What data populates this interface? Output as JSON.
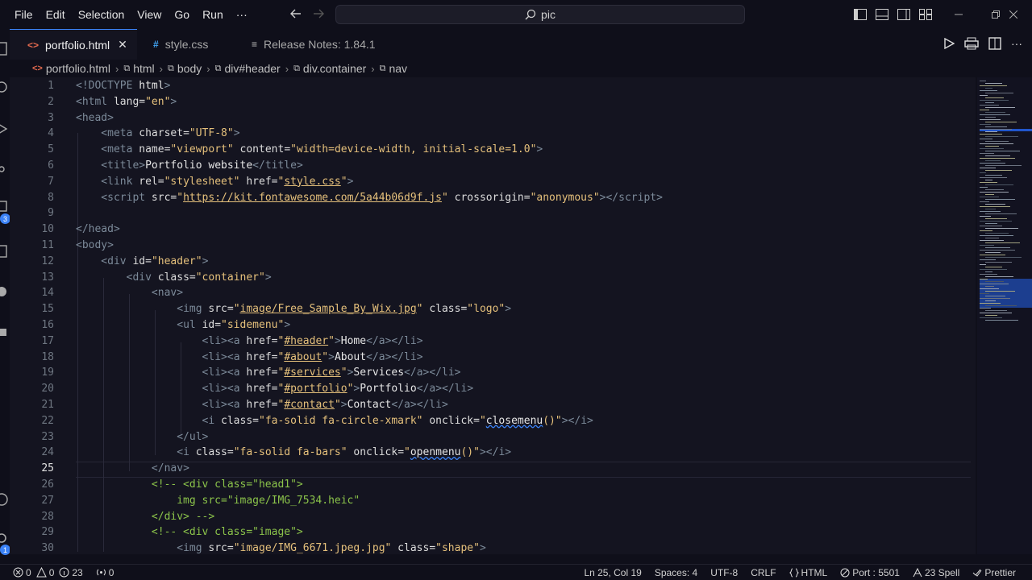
{
  "menu": [
    "File",
    "Edit",
    "Selection",
    "View",
    "Go",
    "Run",
    "···"
  ],
  "search": {
    "text": "pic"
  },
  "tabs": [
    {
      "label": "portfolio.html",
      "icon": "html-file-icon",
      "active": true
    },
    {
      "label": "style.css",
      "icon": "css-file-icon",
      "active": false
    },
    {
      "label": "Release Notes: 1.84.1",
      "icon": "release-notes-icon",
      "active": false
    }
  ],
  "breadcrumb": [
    "portfolio.html",
    "html",
    "body",
    "div#header",
    "div.container",
    "nav"
  ],
  "editor": {
    "current_line": 25,
    "lines": [
      [
        [
          "<!",
          "doc"
        ],
        [
          "DOCTYPE ",
          "doc"
        ],
        [
          "html",
          "name"
        ],
        [
          ">",
          "doc"
        ]
      ],
      [
        [
          "<",
          "tag"
        ],
        [
          "html",
          "tag"
        ],
        [
          " lang",
          "attr"
        ],
        [
          "=",
          "attr"
        ],
        [
          "\"en\"",
          "str"
        ],
        [
          ">",
          "tag"
        ]
      ],
      [
        [
          "<",
          "tag"
        ],
        [
          "head",
          "tag"
        ],
        [
          ">",
          "tag"
        ]
      ],
      [
        [
          "    <",
          "tag"
        ],
        [
          "meta",
          "tag"
        ],
        [
          " charset",
          "attr"
        ],
        [
          "=",
          "attr"
        ],
        [
          "\"UTF-8\"",
          "str"
        ],
        [
          ">",
          "tag"
        ]
      ],
      [
        [
          "    <",
          "tag"
        ],
        [
          "meta",
          "tag"
        ],
        [
          " name",
          "attr"
        ],
        [
          "=",
          "attr"
        ],
        [
          "\"viewport\"",
          "str"
        ],
        [
          " content",
          "attr"
        ],
        [
          "=",
          "attr"
        ],
        [
          "\"width=device-width, initial-scale=1.0\"",
          "str"
        ],
        [
          ">",
          "tag"
        ]
      ],
      [
        [
          "    <",
          "tag"
        ],
        [
          "title",
          "tag"
        ],
        [
          ">",
          "tag"
        ],
        [
          "Portfolio website",
          "text"
        ],
        [
          "</",
          "tag"
        ],
        [
          "title",
          "tag"
        ],
        [
          ">",
          "tag"
        ]
      ],
      [
        [
          "    <",
          "tag"
        ],
        [
          "link",
          "tag"
        ],
        [
          " rel",
          "attr"
        ],
        [
          "=",
          "attr"
        ],
        [
          "\"stylesheet\"",
          "str"
        ],
        [
          " href",
          "attr"
        ],
        [
          "=",
          "attr"
        ],
        [
          "\"",
          "str"
        ],
        [
          "style.css",
          "strul"
        ],
        [
          "\"",
          "str"
        ],
        [
          ">",
          "tag"
        ]
      ],
      [
        [
          "    <",
          "tag"
        ],
        [
          "script",
          "tag"
        ],
        [
          " src",
          "attr"
        ],
        [
          "=",
          "attr"
        ],
        [
          "\"",
          "str"
        ],
        [
          "https://kit.fontawesome.com/5a44b06d9f.js",
          "strul"
        ],
        [
          "\"",
          "str"
        ],
        [
          " crossorigin",
          "attr"
        ],
        [
          "=",
          "attr"
        ],
        [
          "\"anonymous\"",
          "str"
        ],
        [
          "></",
          "tag"
        ],
        [
          "script",
          "tag"
        ],
        [
          ">",
          "tag"
        ]
      ],
      [],
      [
        [
          "</",
          "tag"
        ],
        [
          "head",
          "tag"
        ],
        [
          ">",
          "tag"
        ]
      ],
      [
        [
          "<",
          "tag"
        ],
        [
          "body",
          "tag"
        ],
        [
          ">",
          "tag"
        ]
      ],
      [
        [
          "    <",
          "tag"
        ],
        [
          "div",
          "tag"
        ],
        [
          " id",
          "attr"
        ],
        [
          "=",
          "attr"
        ],
        [
          "\"header\"",
          "str"
        ],
        [
          ">",
          "tag"
        ]
      ],
      [
        [
          "        <",
          "tag"
        ],
        [
          "div",
          "tag"
        ],
        [
          " class",
          "attr"
        ],
        [
          "=",
          "attr"
        ],
        [
          "\"container\"",
          "str"
        ],
        [
          ">",
          "tag"
        ]
      ],
      [
        [
          "            <",
          "tag"
        ],
        [
          "nav",
          "tag"
        ],
        [
          ">",
          "tag"
        ]
      ],
      [
        [
          "                <",
          "tag"
        ],
        [
          "img",
          "tag"
        ],
        [
          " src",
          "attr"
        ],
        [
          "=",
          "attr"
        ],
        [
          "\"",
          "str"
        ],
        [
          "image/Free_Sample_By_Wix.jpg",
          "strul"
        ],
        [
          "\"",
          "str"
        ],
        [
          " class",
          "attr"
        ],
        [
          "=",
          "attr"
        ],
        [
          "\"logo\"",
          "str"
        ],
        [
          ">",
          "tag"
        ]
      ],
      [
        [
          "                <",
          "tag"
        ],
        [
          "ul",
          "tag"
        ],
        [
          " id",
          "attr"
        ],
        [
          "=",
          "attr"
        ],
        [
          "\"sidemenu\"",
          "str"
        ],
        [
          ">",
          "tag"
        ]
      ],
      [
        [
          "                    <",
          "tag"
        ],
        [
          "li",
          "tag"
        ],
        [
          "><",
          "tag"
        ],
        [
          "a",
          "tag"
        ],
        [
          " href",
          "attr"
        ],
        [
          "=",
          "attr"
        ],
        [
          "\"",
          "str"
        ],
        [
          "#header",
          "strul"
        ],
        [
          "\"",
          "str"
        ],
        [
          ">",
          "tag"
        ],
        [
          "Home",
          "text"
        ],
        [
          "</",
          "tag"
        ],
        [
          "a",
          "tag"
        ],
        [
          "></",
          "tag"
        ],
        [
          "li",
          "tag"
        ],
        [
          ">",
          "tag"
        ]
      ],
      [
        [
          "                    <",
          "tag"
        ],
        [
          "li",
          "tag"
        ],
        [
          "><",
          "tag"
        ],
        [
          "a",
          "tag"
        ],
        [
          " href",
          "attr"
        ],
        [
          "=",
          "attr"
        ],
        [
          "\"",
          "str"
        ],
        [
          "#about",
          "strul"
        ],
        [
          "\"",
          "str"
        ],
        [
          ">",
          "tag"
        ],
        [
          "About",
          "text"
        ],
        [
          "</",
          "tag"
        ],
        [
          "a",
          "tag"
        ],
        [
          "></",
          "tag"
        ],
        [
          "li",
          "tag"
        ],
        [
          ">",
          "tag"
        ]
      ],
      [
        [
          "                    <",
          "tag"
        ],
        [
          "li",
          "tag"
        ],
        [
          "><",
          "tag"
        ],
        [
          "a",
          "tag"
        ],
        [
          " href",
          "attr"
        ],
        [
          "=",
          "attr"
        ],
        [
          "\"",
          "str"
        ],
        [
          "#services",
          "strul"
        ],
        [
          "\"",
          "str"
        ],
        [
          ">",
          "tag"
        ],
        [
          "Services",
          "text"
        ],
        [
          "</",
          "tag"
        ],
        [
          "a",
          "tag"
        ],
        [
          "></",
          "tag"
        ],
        [
          "li",
          "tag"
        ],
        [
          ">",
          "tag"
        ]
      ],
      [
        [
          "                    <",
          "tag"
        ],
        [
          "li",
          "tag"
        ],
        [
          "><",
          "tag"
        ],
        [
          "a",
          "tag"
        ],
        [
          " href",
          "attr"
        ],
        [
          "=",
          "attr"
        ],
        [
          "\"",
          "str"
        ],
        [
          "#portfolio",
          "strul"
        ],
        [
          "\"",
          "str"
        ],
        [
          ">",
          "tag"
        ],
        [
          "Portfolio",
          "text"
        ],
        [
          "</",
          "tag"
        ],
        [
          "a",
          "tag"
        ],
        [
          "></",
          "tag"
        ],
        [
          "li",
          "tag"
        ],
        [
          ">",
          "tag"
        ]
      ],
      [
        [
          "                    <",
          "tag"
        ],
        [
          "li",
          "tag"
        ],
        [
          "><",
          "tag"
        ],
        [
          "a",
          "tag"
        ],
        [
          " href",
          "attr"
        ],
        [
          "=",
          "attr"
        ],
        [
          "\"",
          "str"
        ],
        [
          "#contact",
          "strul"
        ],
        [
          "\"",
          "str"
        ],
        [
          ">",
          "tag"
        ],
        [
          "Contact",
          "text"
        ],
        [
          "</",
          "tag"
        ],
        [
          "a",
          "tag"
        ],
        [
          "></",
          "tag"
        ],
        [
          "li",
          "tag"
        ],
        [
          ">",
          "tag"
        ]
      ],
      [
        [
          "                    <",
          "tag"
        ],
        [
          "i",
          "tag"
        ],
        [
          " class",
          "attr"
        ],
        [
          "=",
          "attr"
        ],
        [
          "\"fa-solid fa-circle-xmark\"",
          "str"
        ],
        [
          " onclick",
          "attr"
        ],
        [
          "=",
          "attr"
        ],
        [
          "\"",
          "str"
        ],
        [
          "closemenu",
          "strsq"
        ],
        [
          "()\"",
          "str"
        ],
        [
          "></",
          "tag"
        ],
        [
          "i",
          "tag"
        ],
        [
          ">",
          "tag"
        ]
      ],
      [
        [
          "                </",
          "tag"
        ],
        [
          "ul",
          "tag"
        ],
        [
          ">",
          "tag"
        ]
      ],
      [
        [
          "                <",
          "tag"
        ],
        [
          "i",
          "tag"
        ],
        [
          " class",
          "attr"
        ],
        [
          "=",
          "attr"
        ],
        [
          "\"fa-solid fa-bars\"",
          "str"
        ],
        [
          " onclick",
          "attr"
        ],
        [
          "=",
          "attr"
        ],
        [
          "\"",
          "str"
        ],
        [
          "openmenu",
          "strsq"
        ],
        [
          "()\"",
          "str"
        ],
        [
          "></",
          "tag"
        ],
        [
          "i",
          "tag"
        ],
        [
          ">",
          "tag"
        ]
      ],
      [
        [
          "            </",
          "tag"
        ],
        [
          "nav",
          "tag"
        ],
        [
          ">",
          "tag"
        ]
      ],
      [
        [
          "            <!-- <div class=\"head1\">",
          "com"
        ]
      ],
      [
        [
          "                img src=\"image/IMG_7534.heic\"",
          "com"
        ]
      ],
      [
        [
          "            </div> -->",
          "com"
        ]
      ],
      [
        [
          "            <!-- <div class=\"image\">",
          "com"
        ]
      ],
      [
        [
          "                <",
          "tag"
        ],
        [
          "img",
          "tag"
        ],
        [
          " src",
          "attr"
        ],
        [
          "=",
          "attr"
        ],
        [
          "\"image/IMG_6671.jpeg.jpg\"",
          "str"
        ],
        [
          " class",
          "attr"
        ],
        [
          "=",
          "attr"
        ],
        [
          "\"shape\"",
          "str"
        ],
        [
          ">",
          "tag"
        ]
      ]
    ]
  },
  "status": {
    "errors": "0",
    "warnings": "0",
    "info": "23",
    "ports": "0",
    "position": "Ln 25, Col 19",
    "spaces": "Spaces: 4",
    "encoding": "UTF-8",
    "eol": "CRLF",
    "language": "HTML",
    "port": "Port : 5501",
    "spell": "23 Spell",
    "prettier": "Prettier"
  },
  "activity_badges": [
    "3",
    "1"
  ],
  "colors": {
    "accent": "#3b82f6",
    "string": "#e5c07b",
    "comment": "#8bc34a",
    "tag": "#7c8a99",
    "background": "#141420"
  }
}
